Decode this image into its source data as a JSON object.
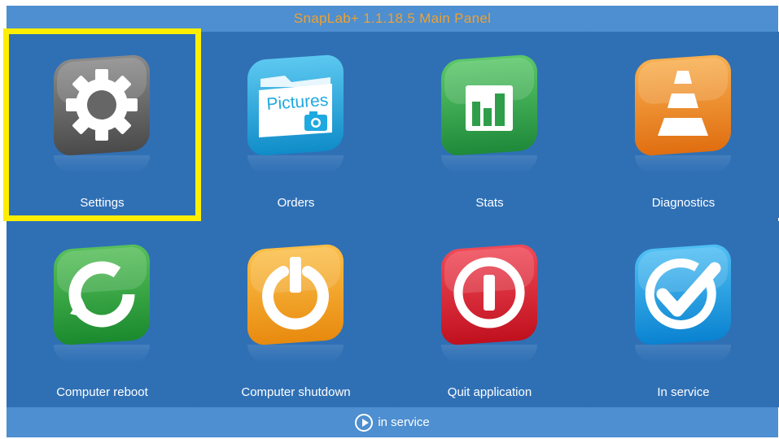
{
  "window": {
    "title": "SnapLab+ 1.1.18.5 Main Panel"
  },
  "tiles": [
    {
      "label": "Settings",
      "icon": "gear-icon",
      "color": "#666666",
      "selected": true
    },
    {
      "label": "Orders",
      "icon": "pictures-folder-icon",
      "icon_text": "Pictures",
      "color": "#1ea9e1"
    },
    {
      "label": "Stats",
      "icon": "bar-chart-icon",
      "color": "#2e9e4a"
    },
    {
      "label": "Diagnostics",
      "icon": "traffic-cone-icon",
      "color": "#f08a1c"
    },
    {
      "label": "Computer reboot",
      "icon": "refresh-icon",
      "color": "#2e9a3e"
    },
    {
      "label": "Computer shutdown",
      "icon": "power-icon",
      "color": "#f0a018"
    },
    {
      "label": "Quit application",
      "icon": "quit-icon",
      "color": "#e01c2e"
    },
    {
      "label": "In service",
      "icon": "checkmark-icon",
      "color": "#1e9ae0"
    }
  ],
  "status": {
    "text": "in service",
    "icon": "play-circle-icon"
  },
  "colors": {
    "background": "#2f6fb3",
    "bars": "#4d8fd0",
    "title_text": "#f0a030",
    "selection": "#ffee00"
  }
}
